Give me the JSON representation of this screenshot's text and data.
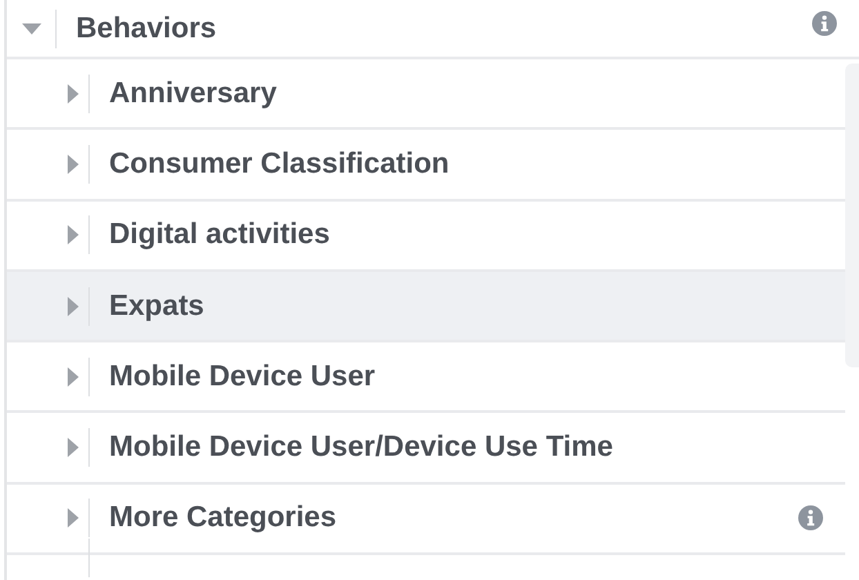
{
  "category": {
    "label": "Behaviors",
    "expanded": true,
    "info": true,
    "children": [
      {
        "label": "Anniversary",
        "expanded": false,
        "selected": false,
        "info": false
      },
      {
        "label": "Consumer Classification",
        "expanded": false,
        "selected": false,
        "info": false
      },
      {
        "label": "Digital activities",
        "expanded": false,
        "selected": false,
        "info": false
      },
      {
        "label": "Expats",
        "expanded": false,
        "selected": true,
        "info": false
      },
      {
        "label": "Mobile Device User",
        "expanded": false,
        "selected": false,
        "info": false
      },
      {
        "label": "Mobile Device User/Device Use Time",
        "expanded": false,
        "selected": false,
        "info": false
      },
      {
        "label": "More Categories",
        "expanded": false,
        "selected": false,
        "info": true
      }
    ]
  }
}
